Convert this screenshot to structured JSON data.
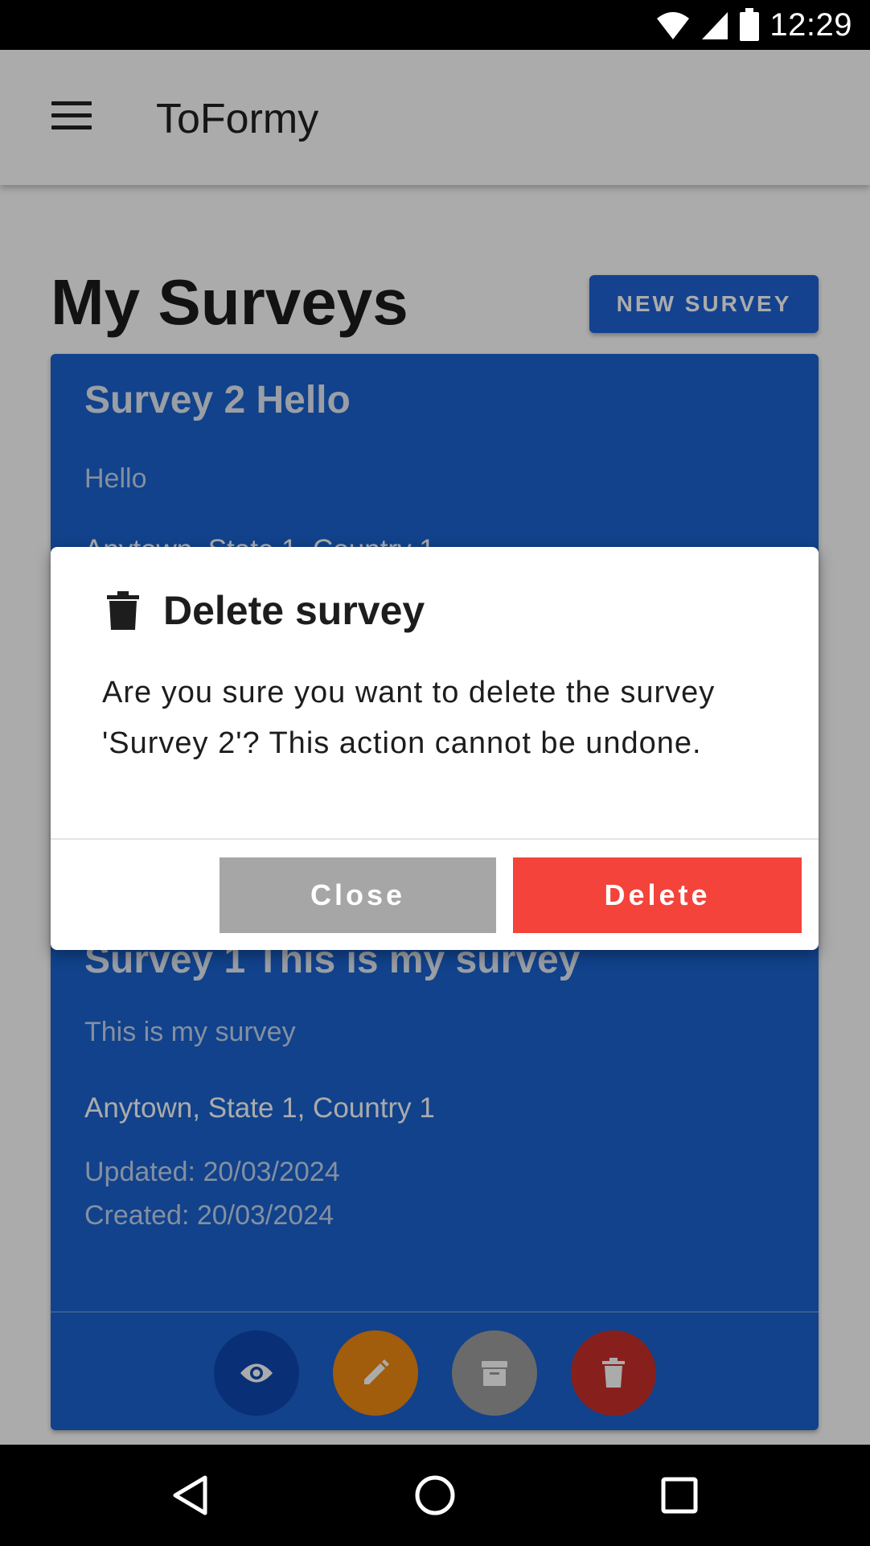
{
  "status_bar": {
    "time": "12:29"
  },
  "app_bar": {
    "title": "ToFormy"
  },
  "page": {
    "title": "My Surveys",
    "new_survey_label": "NEW SURVEY"
  },
  "surveys": [
    {
      "title": "Survey 2 Hello",
      "description": "Hello",
      "location": "Anytown, State 1, Country 1"
    },
    {
      "title": "Survey 1 This is my survey",
      "description": "This is my survey",
      "location": "Anytown, State 1, Country 1",
      "updated": "Updated: 20/03/2024",
      "created": "Created: 20/03/2024",
      "action_icons": [
        "eye-icon",
        "pencil-icon",
        "archive-icon",
        "trash-icon"
      ]
    }
  ],
  "dialog": {
    "title": "Delete survey",
    "message": "Are you sure you want to delete the survey 'Survey 2'? This action cannot be undone.",
    "close_label": "Close",
    "delete_label": "Delete",
    "icon": "trash-icon"
  },
  "colors": {
    "primary": "#1a63cf",
    "danger": "#f4433a",
    "edit": "#f08a12",
    "neutral": "#9e9e9e"
  }
}
